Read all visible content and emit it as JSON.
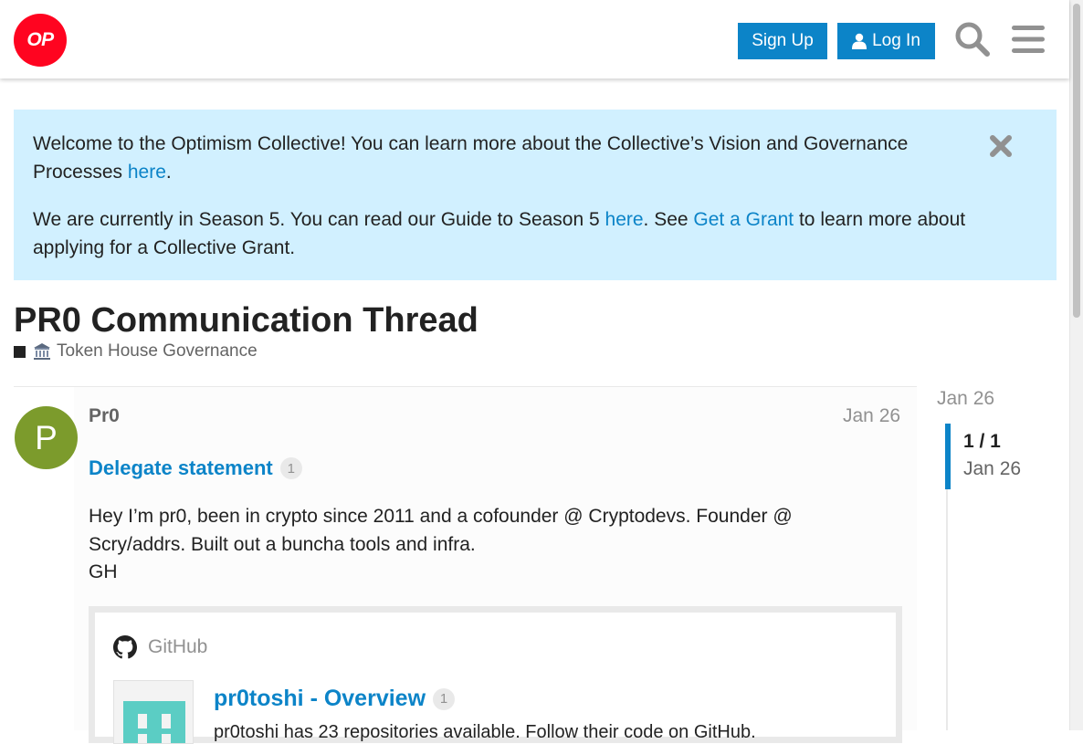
{
  "header": {
    "logo_text": "OP",
    "signup_label": "Sign Up",
    "login_label": "Log In",
    "brand_color": "#ff0420",
    "accent_color": "#0c84c8"
  },
  "banner": {
    "p1_text": "Welcome to the Optimism Collective! You can learn more about the Collective’s Vision and Governance Processes ",
    "p1_link": "here",
    "p1_end": ".",
    "p2_text": "We are currently in Season 5. You can read our Guide to Season 5 ",
    "p2_link1": "here",
    "p2_mid": ". See ",
    "p2_link2": "Get a Grant",
    "p2_end": " to learn more about applying for a Collective Grant.",
    "background": "#d1f0ff"
  },
  "topic": {
    "title": "PR0 Communication Thread",
    "category": "Token House Governance",
    "category_icon": "classical-building-emoji"
  },
  "post": {
    "avatar_letter": "P",
    "avatar_color": "#7c9b2c",
    "username": "Pr0",
    "date": "Jan 26",
    "link_text": "Delegate statement",
    "link_clicks": "1",
    "body_line1": "Hey I’m pr0, been in crypto since 2011 and a cofounder @ Cryptodevs. Founder @ Scry/addrs. Built out a buncha tools and infra.",
    "body_line2": "GH",
    "onebox": {
      "source": "GitHub",
      "title": "pr0toshi - Overview",
      "clicks": "1",
      "description": "pr0toshi has 23 repositories available. Follow their code on GitHub."
    }
  },
  "timeline": {
    "top_date": "Jan 26",
    "position": "1 / 1",
    "current_date": "Jan 26"
  }
}
